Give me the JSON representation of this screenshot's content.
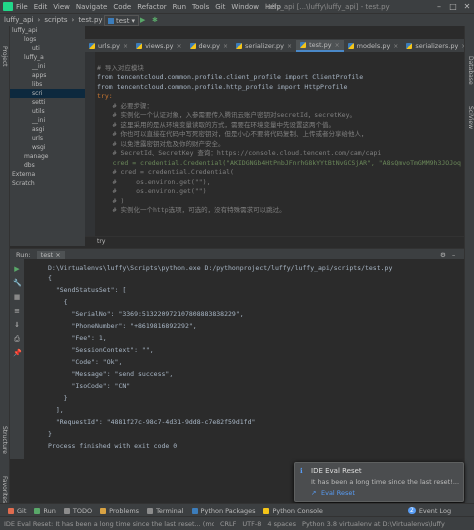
{
  "menu": {
    "items": [
      "File",
      "Edit",
      "View",
      "Navigate",
      "Code",
      "Refactor",
      "Run",
      "Tools",
      "Git",
      "Window",
      "Help"
    ],
    "run_config": "test",
    "window_title": "luffy_api [...\\luffy\\luffy_api] - test.py"
  },
  "nav": {
    "crumbs": [
      "luffy_api",
      "scripts",
      "test.py"
    ]
  },
  "stripes": {
    "project": "Project",
    "structure": "Structure",
    "favorites": "Favorites",
    "database": "Database",
    "sciview": "SciView"
  },
  "project_tree": [
    "luffy_api",
    "logs",
    "uti",
    "luffy_a",
    "__ini",
    "apps",
    "libs",
    "scri",
    "setti",
    "utils",
    "__ini",
    "asgi",
    "urls",
    "wsgi",
    "manage",
    "dbs",
    "Externa",
    "Scratch"
  ],
  "tabs": [
    {
      "label": "urls.py",
      "active": false
    },
    {
      "label": "views.py",
      "active": false
    },
    {
      "label": "dev.py",
      "active": false
    },
    {
      "label": "serializer.py",
      "active": false
    },
    {
      "label": "test.py",
      "active": true
    },
    {
      "label": "models.py",
      "active": false
    },
    {
      "label": "serializers.py",
      "active": false
    }
  ],
  "editor": {
    "lines": [
      "# 导入对应模块",
      "from tencentcloud.common.profile.client_profile import ClientProfile",
      "from tencentcloud.common.profile.http_profile import HttpProfile",
      "try:",
      "    # 必要步骤：",
      "    # 实例化一个认证对象，入参需要传入腾讯云账户密钥对secretId，secretKey。",
      "    # 这里采用的是从环境变量读取的方式，需要在环境变量中先设置这两个值。",
      "    # 你也可以直接在代码中写死密钥对，但是小心不要将代码复制、上传或者分享给他人，",
      "    # 以免泄露密钥对危及你的财产安全。",
      "    # SecretId、SecretKey 查询：https://console.cloud.tencent.com/cam/capi",
      "    cred = credential.Credential(\"AKIDGNGb4HtPnbJFnrhG8kYYtBtNvGCSjAR\", \"A8sQmvoTmGMM9h3JOJoq",
      "    # cred = credential.Credential(",
      "    #     os.environ.get(\"\"),",
      "    #     os.environ.get(\"\")",
      "    # )",
      "",
      "    # 实例化一个http选项，可选的，没有特殊需求可以跳过。"
    ],
    "breadcrumb": "try"
  },
  "run": {
    "title": "Run:",
    "config": "test",
    "settings_icon": "gear-icon",
    "close_icon": "minimize-icon"
  },
  "console": {
    "command": "D:\\Virtualenvs\\luffy\\Scripts\\python.exe D:/pythonproject/luffy/luffy_api/scripts/test.py",
    "lines": [
      "{",
      "  \"SendStatusSet\": [",
      "    {",
      "      \"SerialNo\": \"3369:513220972107808883838229\",",
      "      \"PhoneNumber\": \"+8619816892292\",",
      "      \"Fee\": 1,",
      "      \"SessionContext\": \"\",",
      "      \"Code\": \"Ok\",",
      "      \"Message\": \"send success\",",
      "      \"IsoCode\": \"CN\"",
      "    }",
      "  ],",
      "  \"RequestId\": \"4881f27c-98c7-4d31-9dd8-c7e82f59d1fd\"",
      "}",
      "",
      "Process finished with exit code 0"
    ]
  },
  "bottom_tabs": [
    "Git",
    "Run",
    "TODO",
    "Problems",
    "Terminal",
    "Python Packages",
    "Python Console"
  ],
  "event_log": {
    "label": "Event Log",
    "count": "2"
  },
  "status": {
    "message": "IDE Eval Reset: It has been a long time since the last reset... (moments ago)",
    "crlf": "CRLF",
    "encoding": "UTF-8",
    "indent": "4 spaces",
    "interpreter": "Python 3.8 virtualenv at D:\\Virtualenvs\\luffy"
  },
  "notification": {
    "title": "IDE Eval Reset",
    "message": "It has been a long time since the last reset!...",
    "link": "Eval Reset"
  },
  "colors": {
    "accent": "#4a88c7",
    "keyword": "#cc7832",
    "string": "#6a8759",
    "comment": "#808080",
    "link": "#287bde"
  }
}
